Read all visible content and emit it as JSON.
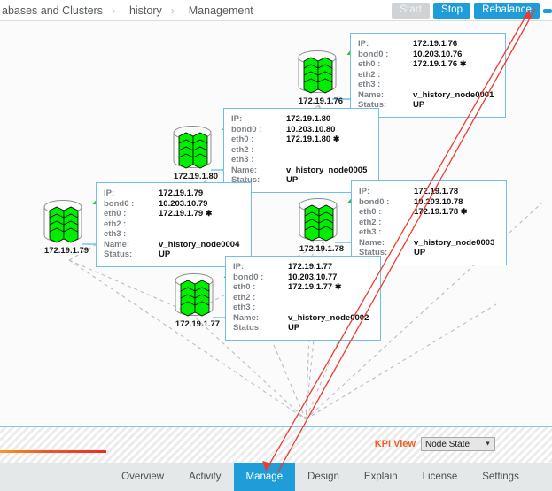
{
  "breadcrumb": {
    "items": [
      {
        "label": "abases and Clusters"
      },
      {
        "label": "history"
      },
      {
        "label": "Management"
      }
    ],
    "separator": "›"
  },
  "toolbar": {
    "buttons": [
      {
        "label": "Start",
        "state": "disabled"
      },
      {
        "label": "Stop",
        "state": "enabled"
      },
      {
        "label": "Rebalance",
        "state": "enabled"
      }
    ]
  },
  "topology": {
    "nodes": [
      {
        "ip_label": "172.19.1.76",
        "icon": "database-node-icon",
        "status_arrow": "arrow-up-icon",
        "info": {
          "ip_key": "IP:",
          "ip_value": "172.19.1.76",
          "bond0_key": "bond0 :",
          "bond0_value": "10.203.10.76",
          "eth0_key": "eth0 :",
          "eth0_value": "172.19.1.76",
          "eth0_star": "✱",
          "eth2_key": "eth2 :",
          "eth2_value": "",
          "eth3_key": "eth3 :",
          "eth3_value": "",
          "name_key": "Name:",
          "name_value": "v_history_node0001",
          "status_key": "Status:",
          "status_value": "UP"
        }
      },
      {
        "ip_label": "172.19.1.80",
        "icon": "database-node-icon",
        "status_arrow": "arrow-up-icon",
        "info": {
          "ip_key": "IP:",
          "ip_value": "172.19.1.80",
          "bond0_key": "bond0 :",
          "bond0_value": "10.203.10.80",
          "eth0_key": "eth0 :",
          "eth0_value": "172.19.1.80",
          "eth0_star": "✱",
          "eth2_key": "eth2 :",
          "eth2_value": "",
          "eth3_key": "eth3 :",
          "eth3_value": "",
          "name_key": "Name:",
          "name_value": "v_history_node0005",
          "status_key": "Status:",
          "status_value": "UP"
        }
      },
      {
        "ip_label": "172.19.1.79",
        "icon": "database-node-icon",
        "status_arrow": "arrow-up-icon",
        "info": {
          "ip_key": "IP:",
          "ip_value": "172.19.1.79",
          "bond0_key": "bond0 :",
          "bond0_value": "10.203.10.79",
          "eth0_key": "eth0 :",
          "eth0_value": "172.19.1.79",
          "eth0_star": "✱",
          "eth2_key": "eth2 :",
          "eth2_value": "",
          "eth3_key": "eth3 :",
          "eth3_value": "",
          "name_key": "Name:",
          "name_value": "v_history_node0004",
          "status_key": "Status:",
          "status_value": "UP"
        }
      },
      {
        "ip_label": "172.19.1.78",
        "icon": "database-node-icon",
        "status_arrow": "arrow-up-icon",
        "info": {
          "ip_key": "IP:",
          "ip_value": "172.19.1.78",
          "bond0_key": "bond0 :",
          "bond0_value": "10.203.10.78",
          "eth0_key": "eth0 :",
          "eth0_value": "172.19.1.78",
          "eth0_star": "✱",
          "eth2_key": "eth2 :",
          "eth2_value": "",
          "eth3_key": "eth3 :",
          "eth3_value": "",
          "name_key": "Name:",
          "name_value": "v_history_node0003",
          "status_key": "Status:",
          "status_value": "UP"
        }
      },
      {
        "ip_label": "172.19.1.77",
        "icon": "database-node-icon",
        "status_arrow": "arrow-up-icon",
        "info": {
          "ip_key": "IP:",
          "ip_value": "172.19.1.77",
          "bond0_key": "bond0 :",
          "bond0_value": "10.203.10.77",
          "eth0_key": "eth0 :",
          "eth0_value": "172.19.1.77",
          "eth0_star": "✱",
          "eth2_key": "eth2 :",
          "eth2_value": "",
          "eth3_key": "eth3 :",
          "eth3_value": "",
          "name_key": "Name:",
          "name_value": "v_history_node0002",
          "status_key": "Status:",
          "status_value": "UP"
        }
      }
    ]
  },
  "kpi": {
    "label": "KPI View",
    "selected": "Node State",
    "options": [
      "Node State"
    ],
    "arrow_icon": "chevron-down-icon"
  },
  "bottom_tabs": {
    "items": [
      {
        "label": "Overview",
        "active": false
      },
      {
        "label": "Activity",
        "active": false
      },
      {
        "label": "Manage",
        "active": true
      },
      {
        "label": "Design",
        "active": false
      },
      {
        "label": "Explain",
        "active": false
      },
      {
        "label": "License",
        "active": false
      },
      {
        "label": "Settings",
        "active": false
      }
    ]
  },
  "colors": {
    "accent_blue": "#1f9dd9",
    "node_green": "#00ee00",
    "kpi_orange": "#e8622a",
    "annotation_red": "#ee3b30",
    "box_border": "#6ec0e8"
  }
}
